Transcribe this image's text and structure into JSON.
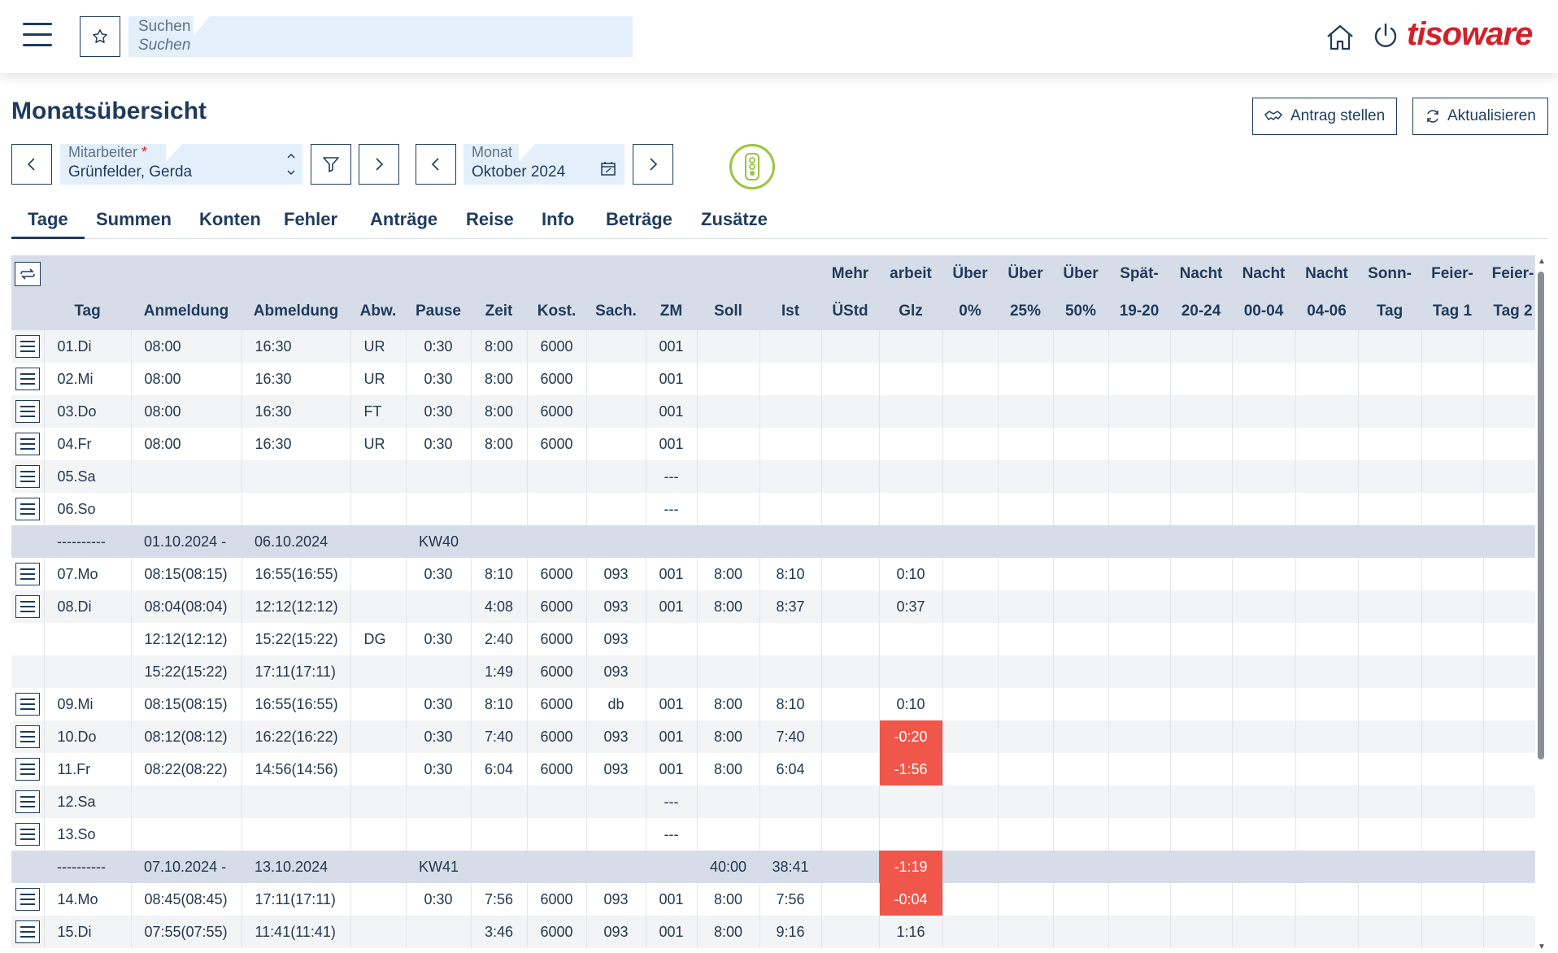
{
  "topbar": {
    "search_label": "Suchen",
    "search_placeholder": "Suchen",
    "logo": "tisoware",
    "icons": {
      "menu": "hamburger-icon",
      "favorite": "star-icon",
      "home": "home-icon",
      "power": "power-icon"
    }
  },
  "page": {
    "title": "Monatsübersicht",
    "antrag_label": "Antrag stellen",
    "refresh_label": "Aktualisieren"
  },
  "filters": {
    "employee_label": "Mitarbeiter",
    "employee_required": "*",
    "employee_value": "Grünfelder, Gerda",
    "month_label": "Monat",
    "month_value": "Oktober 2024"
  },
  "tabs": [
    "Tage",
    "Summen",
    "Konten",
    "Fehler",
    "Anträge",
    "Reise",
    "Info",
    "Beträge",
    "Zusätze"
  ],
  "table": {
    "header_top": [
      "",
      "",
      "",
      "",
      "",
      "",
      "",
      "",
      "",
      "",
      "",
      "",
      "Mehr",
      "arbeit",
      "Über",
      "Über",
      "Über",
      "Spät-",
      "Nacht",
      "Nacht",
      "Nacht",
      "Sonn-",
      "Feier-",
      "Feier-"
    ],
    "header_bottom": [
      "",
      "Tag",
      "Anmeldung",
      "Abmeldung",
      "Abw.",
      "Pause",
      "Zeit",
      "Kost.",
      "Sach.",
      "ZM",
      "Soll",
      "Ist",
      "ÜStd",
      "Glz",
      "0%",
      "25%",
      "50%",
      "19-20",
      "20-24",
      "00-04",
      "04-06",
      "Tag",
      "Tag 1",
      "Tag 2"
    ],
    "rows": [
      {
        "icon": true,
        "cells": [
          "01.Di",
          "08:00",
          "16:30",
          "UR",
          "0:30",
          "8:00",
          "6000",
          "",
          "001",
          "",
          "",
          "",
          ""
        ]
      },
      {
        "icon": true,
        "cells": [
          "02.Mi",
          "08:00",
          "16:30",
          "UR",
          "0:30",
          "8:00",
          "6000",
          "",
          "001",
          "",
          "",
          "",
          ""
        ]
      },
      {
        "icon": true,
        "cells": [
          "03.Do",
          "08:00",
          "16:30",
          "FT",
          "0:30",
          "8:00",
          "6000",
          "",
          "001",
          "",
          "",
          "",
          ""
        ]
      },
      {
        "icon": true,
        "cells": [
          "04.Fr",
          "08:00",
          "16:30",
          "UR",
          "0:30",
          "8:00",
          "6000",
          "",
          "001",
          "",
          "",
          "",
          ""
        ]
      },
      {
        "icon": true,
        "cells": [
          "05.Sa",
          "",
          "",
          "",
          "",
          "",
          "",
          "",
          "---",
          "",
          "",
          "",
          ""
        ]
      },
      {
        "icon": true,
        "cells": [
          "06.So",
          "",
          "",
          "",
          "",
          "",
          "",
          "",
          "---",
          "",
          "",
          "",
          ""
        ]
      },
      {
        "week": true,
        "cells": [
          "----------",
          "01.10.2024 -",
          "06.10.2024",
          "",
          "KW40",
          "",
          "",
          "",
          "",
          "",
          "",
          "",
          ""
        ]
      },
      {
        "icon": true,
        "cells": [
          "07.Mo",
          "08:15(08:15)",
          "16:55(16:55)",
          "",
          "0:30",
          "8:10",
          "6000",
          "093",
          "001",
          "8:00",
          "8:10",
          "",
          "0:10"
        ]
      },
      {
        "icon": true,
        "cells": [
          "08.Di",
          "08:04(08:04)",
          "12:12(12:12)",
          "",
          "",
          "4:08",
          "6000",
          "093",
          "001",
          "8:00",
          "8:37",
          "",
          "0:37"
        ]
      },
      {
        "icon": false,
        "cells": [
          "",
          "12:12(12:12)",
          "15:22(15:22)",
          "DG",
          "0:30",
          "2:40",
          "6000",
          "093",
          "",
          "",
          "",
          "",
          ""
        ]
      },
      {
        "icon": false,
        "cells": [
          "",
          "15:22(15:22)",
          "17:11(17:11)",
          "",
          "",
          "1:49",
          "6000",
          "093",
          "",
          "",
          "",
          "",
          ""
        ]
      },
      {
        "icon": true,
        "cells": [
          "09.Mi",
          "08:15(08:15)",
          "16:55(16:55)",
          "",
          "0:30",
          "8:10",
          "6000",
          "db",
          "001",
          "8:00",
          "8:10",
          "",
          "0:10"
        ]
      },
      {
        "icon": true,
        "neg": true,
        "cells": [
          "10.Do",
          "08:12(08:12)",
          "16:22(16:22)",
          "",
          "0:30",
          "7:40",
          "6000",
          "093",
          "001",
          "8:00",
          "7:40",
          "",
          "-0:20"
        ]
      },
      {
        "icon": true,
        "neg": true,
        "cells": [
          "11.Fr",
          "08:22(08:22)",
          "14:56(14:56)",
          "",
          "0:30",
          "6:04",
          "6000",
          "093",
          "001",
          "8:00",
          "6:04",
          "",
          "-1:56"
        ]
      },
      {
        "icon": true,
        "cells": [
          "12.Sa",
          "",
          "",
          "",
          "",
          "",
          "",
          "",
          "---",
          "",
          "",
          "",
          ""
        ]
      },
      {
        "icon": true,
        "cells": [
          "13.So",
          "",
          "",
          "",
          "",
          "",
          "",
          "",
          "---",
          "",
          "",
          "",
          ""
        ]
      },
      {
        "week": true,
        "neg": true,
        "cells": [
          "----------",
          "07.10.2024 -",
          "13.10.2024",
          "",
          "KW41",
          "",
          "",
          "",
          "",
          "40:00",
          "38:41",
          "",
          "-1:19"
        ]
      },
      {
        "icon": true,
        "neg": true,
        "cells": [
          "14.Mo",
          "08:45(08:45)",
          "17:11(17:11)",
          "",
          "0:30",
          "7:56",
          "6000",
          "093",
          "001",
          "8:00",
          "7:56",
          "",
          "-0:04"
        ]
      },
      {
        "icon": true,
        "cells": [
          "15.Di",
          "07:55(07:55)",
          "11:41(11:41)",
          "",
          "",
          "3:46",
          "6000",
          "093",
          "001",
          "8:00",
          "9:16",
          "",
          "1:16"
        ]
      }
    ]
  },
  "colors": {
    "primary": "#1f3b5c",
    "logo": "#d3202a",
    "negative": "#f0564a",
    "header_bg": "#d6dde8",
    "traffic": "#9bc53d"
  }
}
